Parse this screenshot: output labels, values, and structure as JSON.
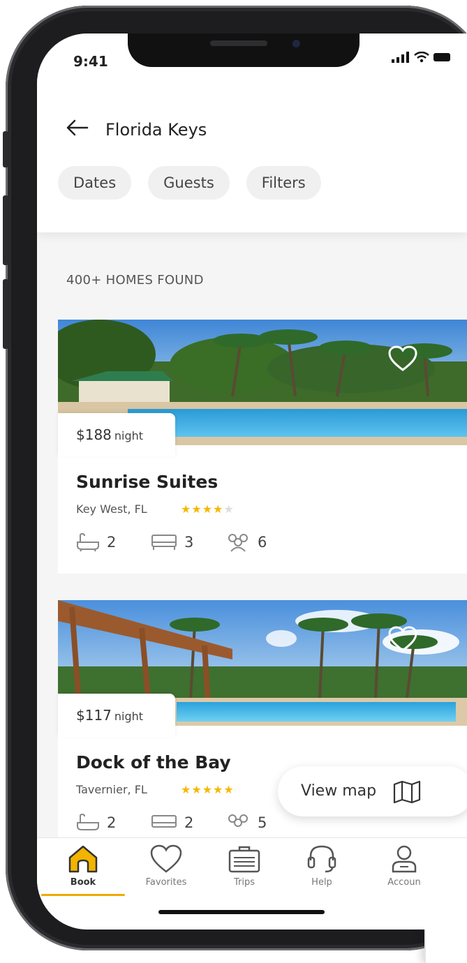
{
  "status_bar": {
    "time": "9:41"
  },
  "header": {
    "back_icon": "arrow-left-icon",
    "title": "Florida Keys"
  },
  "filters": [
    {
      "label": "Dates"
    },
    {
      "label": "Guests"
    },
    {
      "label": "Filters"
    }
  ],
  "results": {
    "count_label": "400+ HOMES FOUND"
  },
  "listings": [
    {
      "price": "$188",
      "price_unit": "night",
      "name": "Sunrise Suites",
      "location": "Key West, FL",
      "rating": 4,
      "stars": "★★★★",
      "stars_empty": "★",
      "baths": "2",
      "beds": "3",
      "guests": "6"
    },
    {
      "price": "$117",
      "price_unit": "night",
      "name": "Dock of the Bay",
      "location": "Tavernier, FL",
      "rating": 5,
      "stars": "★★★★★",
      "stars_empty": "",
      "baths": "2",
      "beds": "2",
      "guests": "5"
    }
  ],
  "view_map": {
    "label": "View map",
    "icon": "map-icon"
  },
  "tabbar": {
    "items": [
      {
        "label": "Book",
        "icon": "home-icon",
        "active": true
      },
      {
        "label": "Favorites",
        "icon": "heart-icon",
        "active": false
      },
      {
        "label": "Trips",
        "icon": "briefcase-icon",
        "active": false
      },
      {
        "label": "Help",
        "icon": "headset-icon",
        "active": false
      },
      {
        "label": "Accoun",
        "icon": "user-icon",
        "active": false
      }
    ]
  },
  "colors": {
    "accent": "#f2a900",
    "star": "#f5b800",
    "text": "#222222",
    "pill_bg": "#f0f0f0"
  }
}
